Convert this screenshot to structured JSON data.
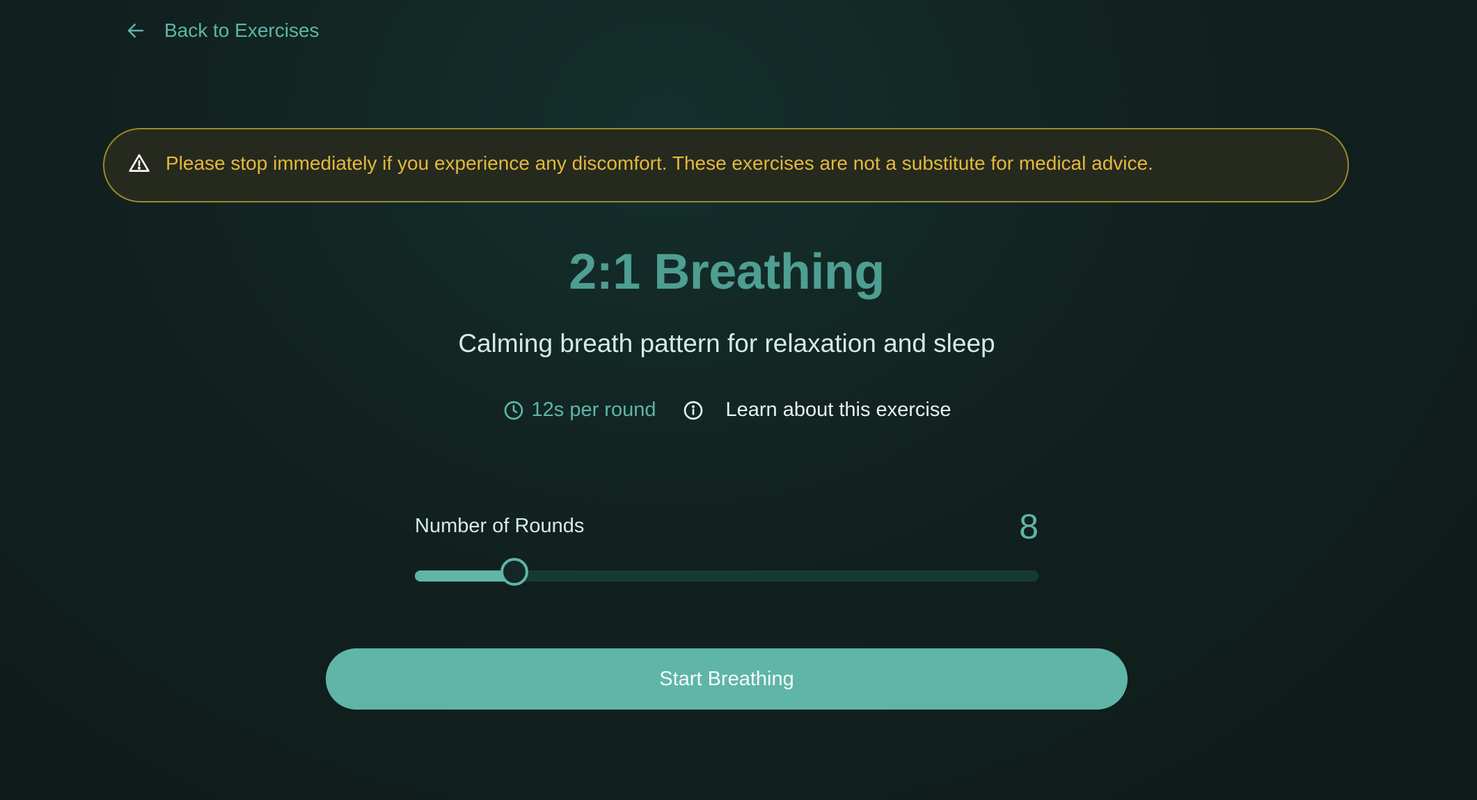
{
  "nav": {
    "back_label": "Back to Exercises",
    "back_icon": "arrow-left-icon"
  },
  "warning": {
    "icon": "warning-triangle-icon",
    "text": "Please stop immediately if you experience any discomfort. These exercises are not a substitute for medical advice."
  },
  "exercise": {
    "title": "2:1 Breathing",
    "subtitle": "Calming breath pattern for relaxation and sleep",
    "duration_icon": "clock-icon",
    "duration": "12s per round",
    "learn_icon": "info-icon",
    "learn_label": "Learn about this exercise"
  },
  "rounds": {
    "label": "Number of Rounds",
    "value": "8",
    "slider_fraction": 0.16
  },
  "actions": {
    "start_label": "Start Breathing"
  },
  "colors": {
    "accent": "#5fb5a8",
    "title": "#4e9e92",
    "warning_text": "#e2b93b",
    "warning_border": "#9c8a2a",
    "background": "#10201f"
  }
}
